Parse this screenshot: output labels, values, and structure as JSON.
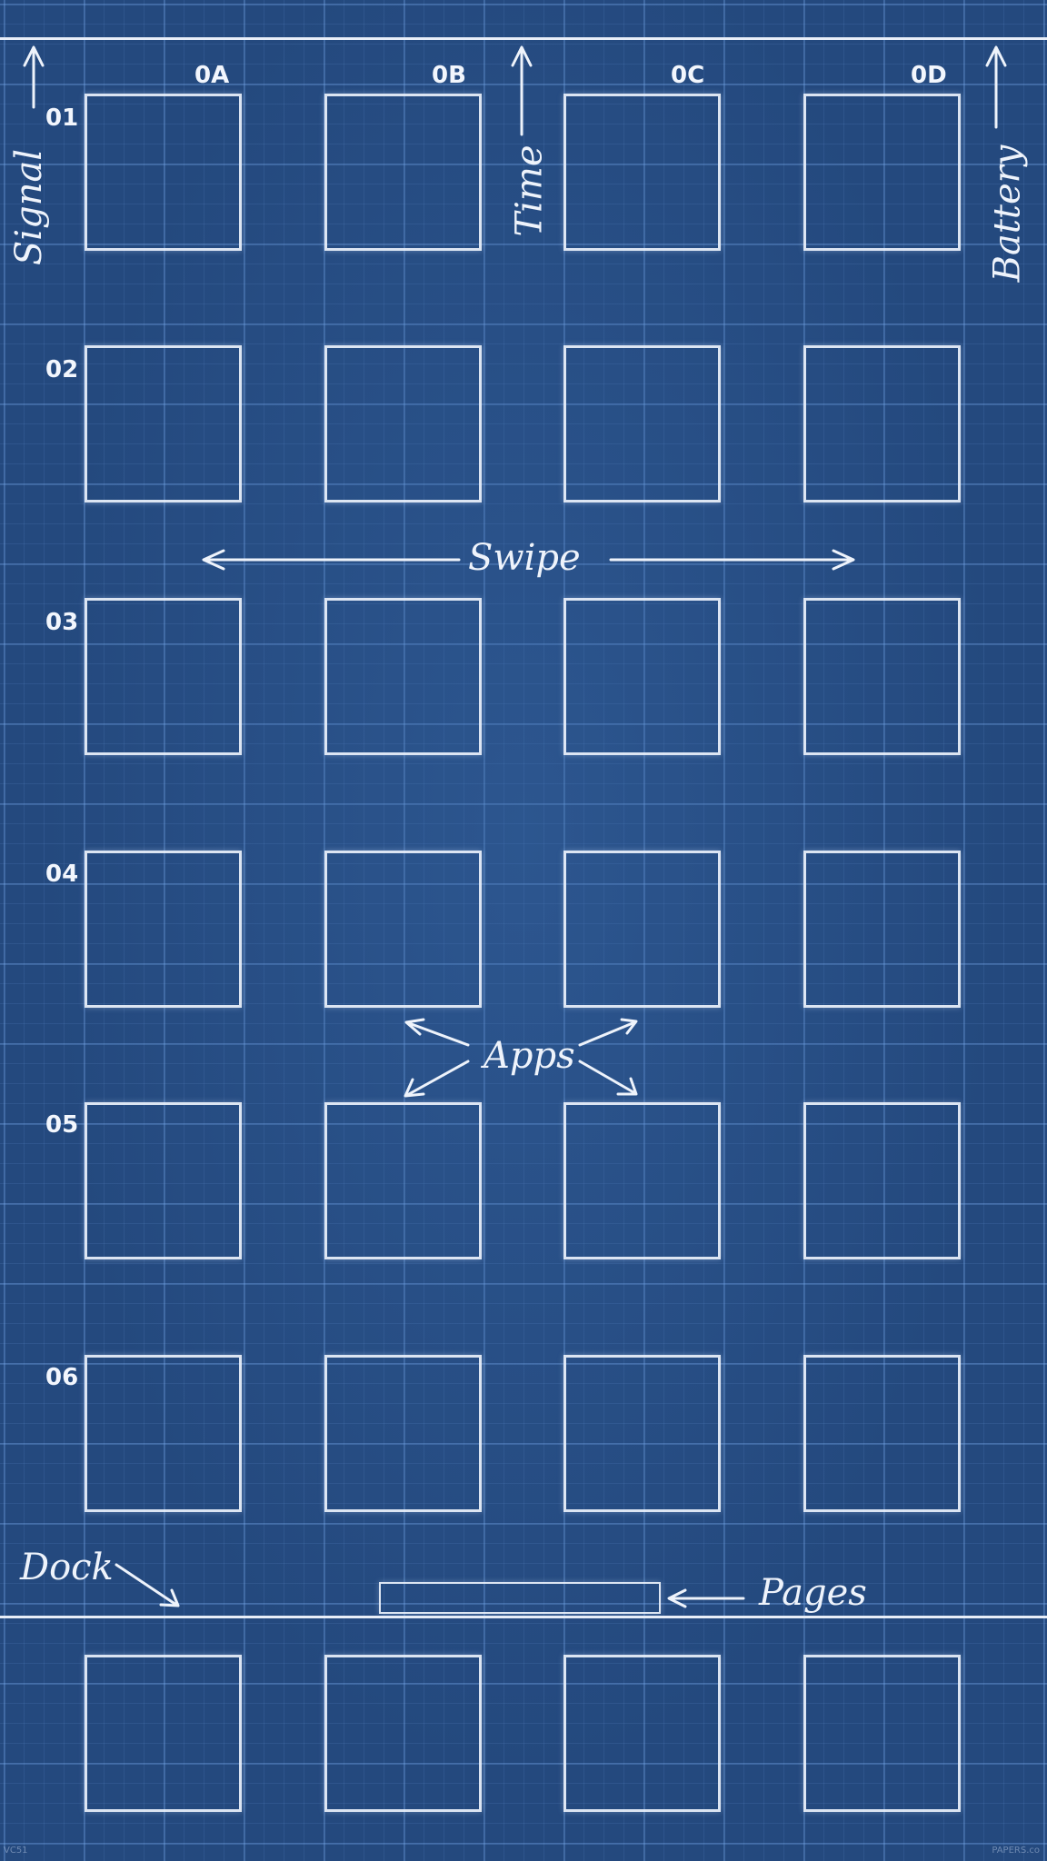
{
  "columns": [
    "0A",
    "0B",
    "0C",
    "0D"
  ],
  "rows": [
    "01",
    "02",
    "03",
    "04",
    "05",
    "06"
  ],
  "annotations": {
    "signal": "Signal",
    "time": "Time",
    "battery": "Battery",
    "swipe": "Swipe",
    "apps": "Apps",
    "dock": "Dock",
    "pages": "Pages"
  },
  "footer": {
    "left": "VC51",
    "right": "PAPERS.co"
  },
  "colors": {
    "background": "#24497e",
    "line": "#e8eef8"
  }
}
